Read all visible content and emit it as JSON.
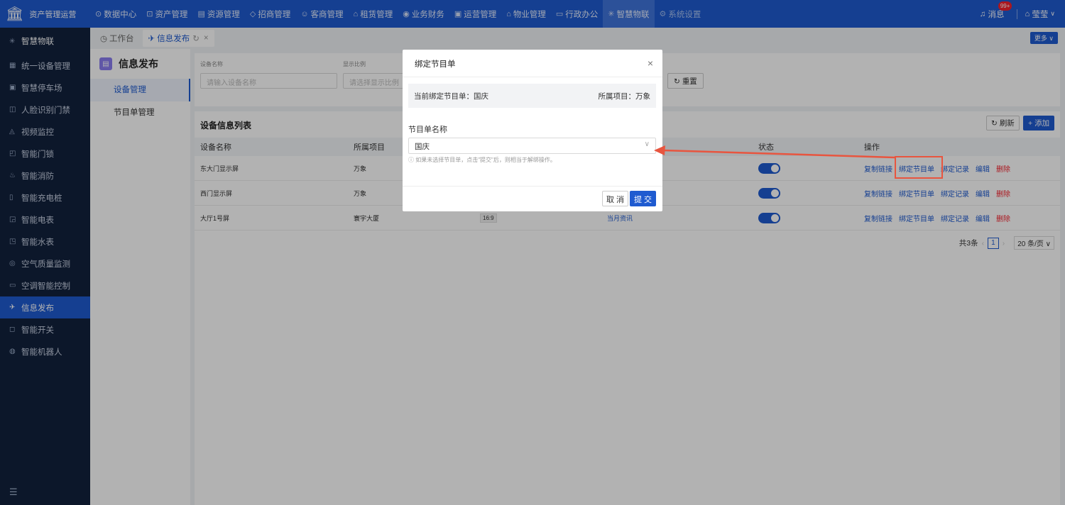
{
  "app": {
    "title": "资产管理运营"
  },
  "topnav": [
    {
      "icon": "⊙",
      "label": "数据中心"
    },
    {
      "icon": "⊡",
      "label": "资产管理"
    },
    {
      "icon": "▤",
      "label": "资源管理"
    },
    {
      "icon": "◇",
      "label": "招商管理"
    },
    {
      "icon": "☺",
      "label": "客商管理"
    },
    {
      "icon": "⌂",
      "label": "租赁管理"
    },
    {
      "icon": "◉",
      "label": "业务财务"
    },
    {
      "icon": "▣",
      "label": "运营管理"
    },
    {
      "icon": "⌂",
      "label": "物业管理"
    },
    {
      "icon": "▭",
      "label": "行政办公"
    },
    {
      "icon": "✳",
      "label": "智慧物联"
    },
    {
      "icon": "⚙",
      "label": "系统设置"
    }
  ],
  "header_right": {
    "messages_label": "消息",
    "messages_badge": "99+",
    "user": "莹莹"
  },
  "sidebar": {
    "header": "智慧物联",
    "items": [
      {
        "icon": "▦",
        "label": "统一设备管理"
      },
      {
        "icon": "▣",
        "label": "智慧停车场"
      },
      {
        "icon": "◫",
        "label": "人脸识别门禁"
      },
      {
        "icon": "◬",
        "label": "视频监控"
      },
      {
        "icon": "◰",
        "label": "智能门锁"
      },
      {
        "icon": "♨",
        "label": "智能消防"
      },
      {
        "icon": "▯",
        "label": "智能充电桩"
      },
      {
        "icon": "◲",
        "label": "智能电表"
      },
      {
        "icon": "◳",
        "label": "智能水表"
      },
      {
        "icon": "◎",
        "label": "空气质量监测"
      },
      {
        "icon": "▭",
        "label": "空调智能控制"
      },
      {
        "icon": "✈",
        "label": "信息发布"
      },
      {
        "icon": "◻",
        "label": "智能开关"
      },
      {
        "icon": "◍",
        "label": "智能机器人"
      }
    ],
    "collapse_icon": "☰"
  },
  "tabs": [
    {
      "label": "工作台"
    },
    {
      "label": "信息发布"
    }
  ],
  "more_label": "更多 ∨",
  "subnav": {
    "title": "信息发布",
    "items": [
      "设备管理",
      "节目单管理"
    ]
  },
  "filter": {
    "device_name_label": "设备名称",
    "device_name_placeholder": "请输入设备名称",
    "ratio_label": "显示比例",
    "ratio_placeholder": "请选择显示比例",
    "reset_label": "重置"
  },
  "list": {
    "title": "设备信息列表",
    "refresh_label": "刷新",
    "add_label": "添加",
    "columns": [
      "设备名称",
      "所属项目",
      "状态",
      "操作"
    ],
    "rows": [
      {
        "name": "东大门显示屏",
        "project": "万象",
        "ratio": "",
        "program": ""
      },
      {
        "name": "西门显示屏",
        "project": "万象",
        "ratio": "",
        "program": ""
      },
      {
        "name": "大厅1号屏",
        "project": "寰宇大厦",
        "ratio": "16:9",
        "program": "当月资讯"
      }
    ],
    "actions": {
      "copy": "复制链接",
      "bind": "绑定节目单",
      "record": "绑定记录",
      "edit": "编辑",
      "delete": "删除"
    },
    "pager": {
      "total": "共3条",
      "page": "1",
      "size": "20 条/页"
    }
  },
  "modal": {
    "title": "绑定节目单",
    "current_label": "当前绑定节目单：国庆",
    "project_label": "所属项目：万象",
    "field_label": "节目单名称",
    "field_value": "国庆",
    "hint": "ⓘ 如果未选择节目单，点击\"提交\"后，则相当于解绑操作。",
    "cancel": "取 消",
    "submit": "提 交"
  },
  "colors": {
    "primary": "#1f5bd0",
    "sidebar": "#12213d",
    "danger": "#f5222d",
    "annotation": "#e8553f"
  }
}
